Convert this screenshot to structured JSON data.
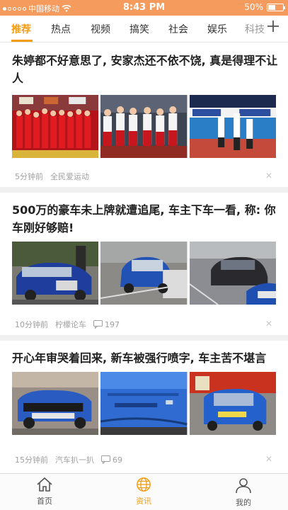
{
  "status_bar": {
    "carrier": "中国移动",
    "time": "8:43 PM",
    "battery": "50%",
    "battery_level": 0.5
  },
  "tabs": [
    {
      "label": "推荐",
      "active": true
    },
    {
      "label": "热点"
    },
    {
      "label": "视频"
    },
    {
      "label": "搞笑"
    },
    {
      "label": "社会"
    },
    {
      "label": "娱乐"
    },
    {
      "label": "科技"
    }
  ],
  "articles": [
    {
      "title": "朱婷都不好意思了, 安家杰还不依不饶, 真是得理不让人",
      "time": "5分钟前",
      "source": "全民爱运动",
      "comments": ""
    },
    {
      "title": "500万的豪车未上牌就遭追尾, 车主下车一看, 称: 你车刚好够赔!",
      "time": "10分钟前",
      "source": "柠檬论车",
      "comments": "197"
    },
    {
      "title": "开心年审哭着回来, 新车被强行喷字, 车主苦不堪言",
      "time": "15分钟前",
      "source": "汽车扒一扒",
      "comments": "69"
    }
  ],
  "bottom_nav": [
    {
      "label": "首页",
      "icon": "home-icon"
    },
    {
      "label": "资讯",
      "icon": "globe-icon",
      "active": true
    },
    {
      "label": "我的",
      "icon": "user-icon"
    }
  ],
  "colors": {
    "accent": "#f39c12",
    "status_bar": "#f49b5d"
  }
}
